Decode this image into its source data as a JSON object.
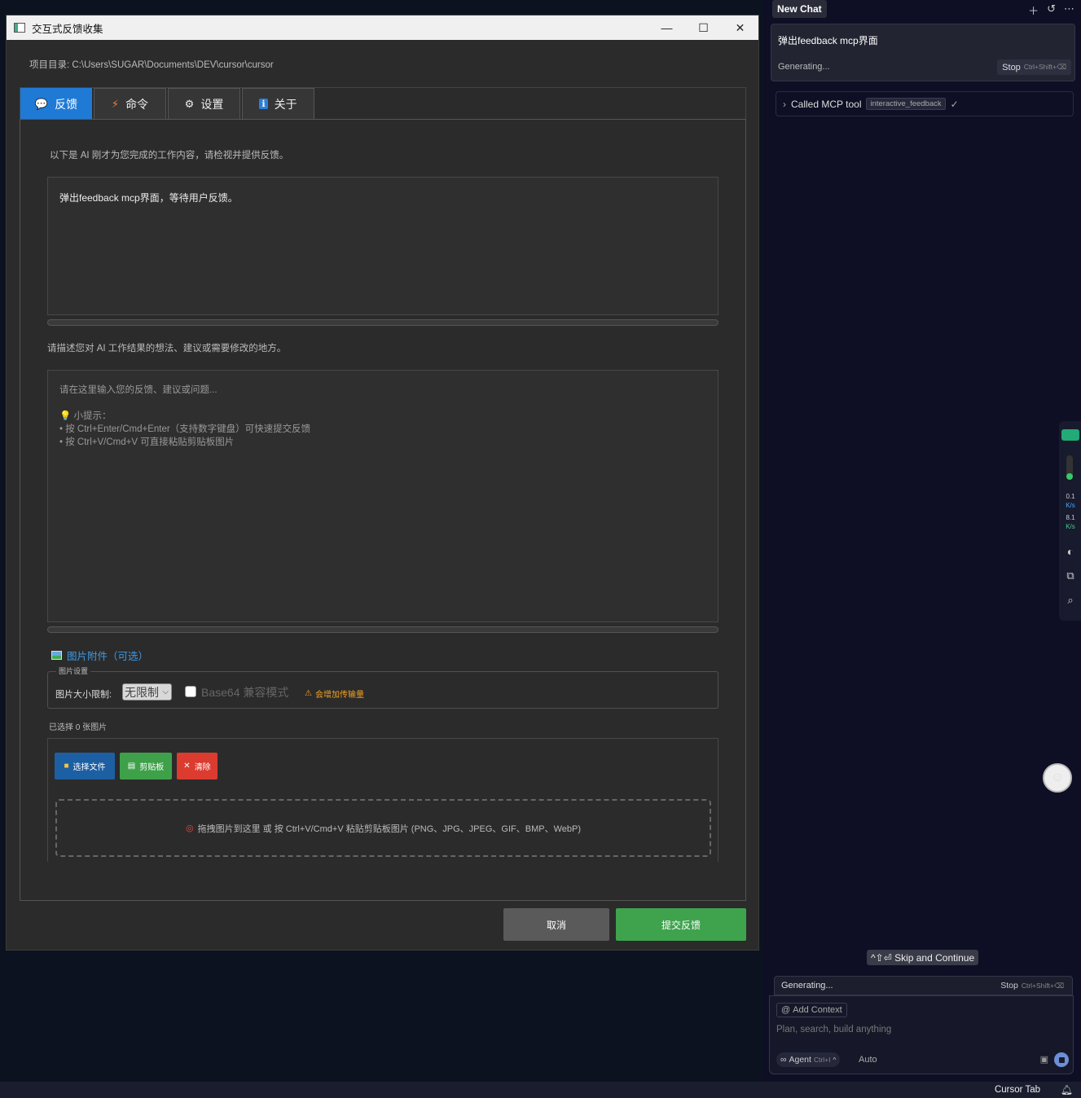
{
  "window": {
    "title": "交互式反馈收集",
    "project_dir": "项目目录: C:\\Users\\SUGAR\\Documents\\DEV\\cursor\\cursor",
    "controls": {
      "minimize": "—",
      "maximize": "☐",
      "close": "✕"
    }
  },
  "tabs": [
    {
      "icon": "💬",
      "label": "反馈"
    },
    {
      "icon": "⚡",
      "label": "命令"
    },
    {
      "icon": "⚙",
      "label": "设置"
    },
    {
      "icon": "ℹ",
      "label": "关于"
    }
  ],
  "feedback": {
    "intro": "以下是 AI 刚才为您完成的工作内容，请检视并提供反馈。",
    "summary": "弹出feedback mcp界面，等待用户反馈。",
    "describe": "请描述您对 AI 工作结果的想法、建议或需要修改的地方。",
    "placeholder_line1": "请在这里输入您的反馈、建议或问题...",
    "tip_title": "💡 小提示：",
    "tip_1": "• 按 Ctrl+Enter/Cmd+Enter（支持数字键盘）可快速提交反馈",
    "tip_2": "• 按 Ctrl+V/Cmd+V 可直接粘贴剪贴板图片"
  },
  "images": {
    "heading": "图片附件（可选）",
    "settings_legend": "图片设置",
    "size_label": "图片大小限制:",
    "size_value": "无限制",
    "base64_label": "Base64 兼容模式",
    "warning": "会增加传输量",
    "selected_count": "已选择 0 张图片",
    "btn_file": "选择文件",
    "btn_clipboard": "剪贴板",
    "btn_clear": "清除",
    "drop_text": "拖拽图片到这里 或 按 Ctrl+V/Cmd+V 粘贴剪贴板图片 (PNG、JPG、JPEG、GIF、BMP、WebP)"
  },
  "actions": {
    "cancel": "取消",
    "submit": "提交反馈"
  },
  "sidebar": {
    "new_chat": "New Chat",
    "message": "弹出feedback mcp界面",
    "generating": "Generating...",
    "stop": "Stop",
    "stop_shortcut": "Ctrl+Shift+⌫",
    "mcp_label": "Called MCP tool",
    "mcp_tool": "interactive_feedback",
    "net_up": "0.1",
    "net_up_unit": "K/s",
    "net_down": "8.1",
    "net_down_unit": "K/s",
    "skip": "^⇧⏎ Skip and Continue",
    "add_context": "Add Context",
    "input_placeholder": "Plan, search, build anything",
    "agent": "Agent",
    "agent_shortcut": "Ctrl+I",
    "model": "Auto"
  },
  "statusbar": {
    "cursor_tab": "Cursor Tab"
  },
  "colors": {
    "accent": "#1f7ad6",
    "submit": "#3fa34d",
    "clear": "#dc3b2f",
    "file": "#1d5fa3"
  }
}
